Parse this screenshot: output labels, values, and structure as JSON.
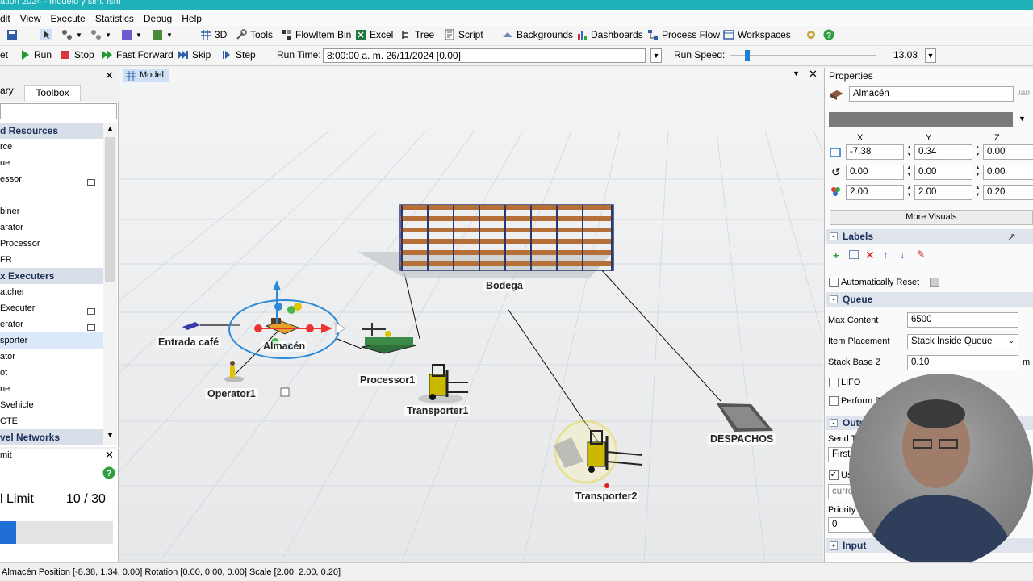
{
  "window_title": "ation 2024 - modelo y sim. fsm",
  "menu": [
    "dit",
    "View",
    "Execute",
    "Statistics",
    "Debug",
    "Help"
  ],
  "toolbar": {
    "items": [
      "3D",
      "Tools",
      "FlowItem Bin",
      "Excel",
      "Tree",
      "Script",
      "Backgrounds",
      "Dashboards",
      "Process Flow",
      "Workspaces"
    ]
  },
  "runbar": {
    "reset": "et",
    "run": "Run",
    "stop": "Stop",
    "fast_forward": "Fast Forward",
    "skip": "Skip",
    "step": "Step",
    "run_time_label": "Run Time:",
    "run_time_value": "8:00:00 a. m.  26/11/2024  [0.00]",
    "run_speed_label": "Run Speed:",
    "run_speed_value": "13.03",
    "run_speed_fraction": 0.1
  },
  "library": {
    "tabs": [
      "ary",
      "Toolbox"
    ],
    "cat_fixed": "d Resources",
    "fixed_items": [
      "rce",
      "ue",
      "essor",
      "",
      "biner",
      "arator",
      "Processor",
      "FR"
    ],
    "cat_task": "x Executers",
    "task_items": [
      "atcher",
      "Executer",
      "erator",
      "sporter",
      "ator",
      "ot",
      "ne",
      "Svehicle",
      "CTE"
    ],
    "cat_travel": "vel Networks"
  },
  "limit_panel": {
    "title": "mit",
    "label": "l Limit",
    "value": "10 / 30",
    "progress_fraction": 0.14
  },
  "model": {
    "tab_label": "Model",
    "objects": {
      "source": "Entrada café",
      "queue": "Almacén",
      "operator": "Operator1",
      "processor": "Processor1",
      "transporter1": "Transporter1",
      "rack": "Bodega",
      "transporter2": "Transporter2",
      "sink": "DESPACHOS"
    }
  },
  "properties": {
    "title": "Properties",
    "object_name": "Almacén",
    "axis": [
      "X",
      "Y",
      "Z"
    ],
    "position": [
      "-7.38",
      "0.34",
      "0.00"
    ],
    "rotation": [
      "0.00",
      "0.00",
      "0.00"
    ],
    "size": [
      "2.00",
      "2.00",
      "0.20"
    ],
    "more_visuals": "More Visuals",
    "labels_section": "Labels",
    "auto_reset": "Automatically Reset",
    "queue_section": "Queue",
    "max_content_label": "Max Content",
    "max_content_value": "6500",
    "item_placement_label": "Item Placement",
    "item_placement_value": "Stack Inside Queue",
    "stack_base_label": "Stack Base Z",
    "stack_base_value": "0.10",
    "stack_unit": "m",
    "lifo": "LIFO",
    "perform_batching": "Perform B",
    "output_section": "Outp",
    "send_to_label": "Send T",
    "send_to_value": "First a",
    "use_transport": "Us",
    "current_value": "curre",
    "priority_label": "Priority",
    "priority_value": "0",
    "input_section": "Input"
  },
  "status": "Almacén Position [-8.38, 1.34, 0.00] Rotation [0.00, 0.00, 0.00] Scale [2.00, 2.00, 0.20]"
}
